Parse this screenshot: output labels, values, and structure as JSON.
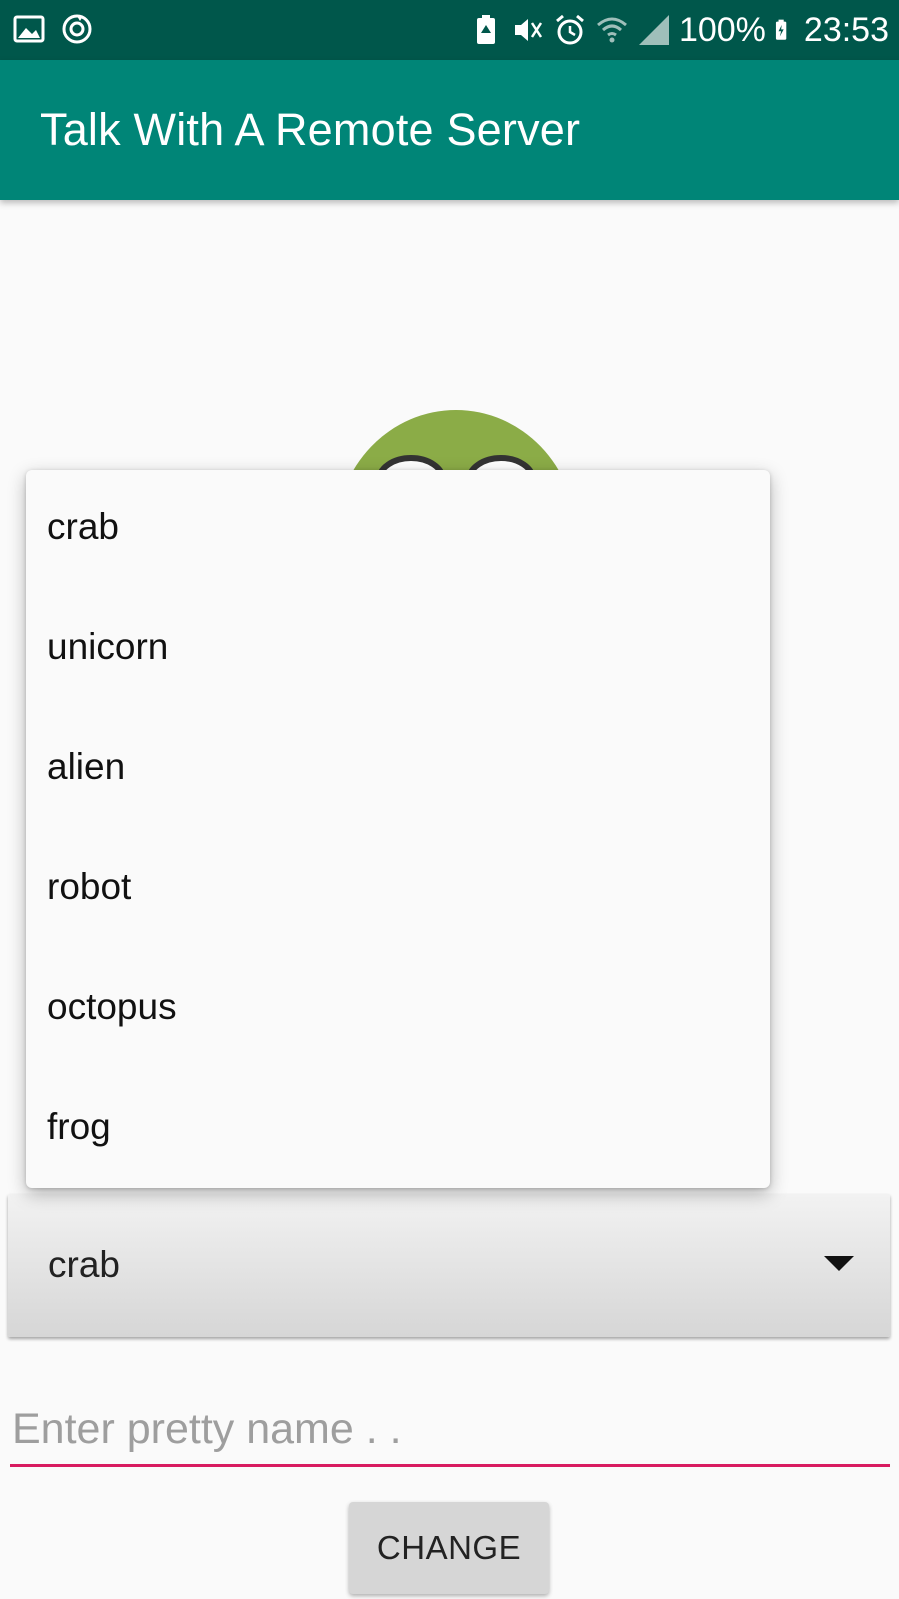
{
  "status_bar": {
    "icons": [
      "image-icon",
      "sync-icon",
      "battery-saver-icon",
      "mute-icon",
      "alarm-icon",
      "wifi-icon",
      "signal-icon",
      "battery-charging-icon"
    ],
    "battery": "100%",
    "time": "23:53"
  },
  "app_bar": {
    "title": "Talk With A Remote Server"
  },
  "avatar": {
    "icon": "frog-avatar-icon"
  },
  "dropdown": {
    "items": [
      "crab",
      "unicorn",
      "alien",
      "robot",
      "octopus",
      "frog"
    ]
  },
  "spinner": {
    "selected": "crab"
  },
  "name_input": {
    "placeholder": "Enter pretty name . .",
    "value": ""
  },
  "change_button": {
    "label": "CHANGE"
  },
  "colors": {
    "status_bar": "#00574b",
    "app_bar": "#008577",
    "accent": "#d81b60",
    "avatar_green": "#8bac47"
  }
}
